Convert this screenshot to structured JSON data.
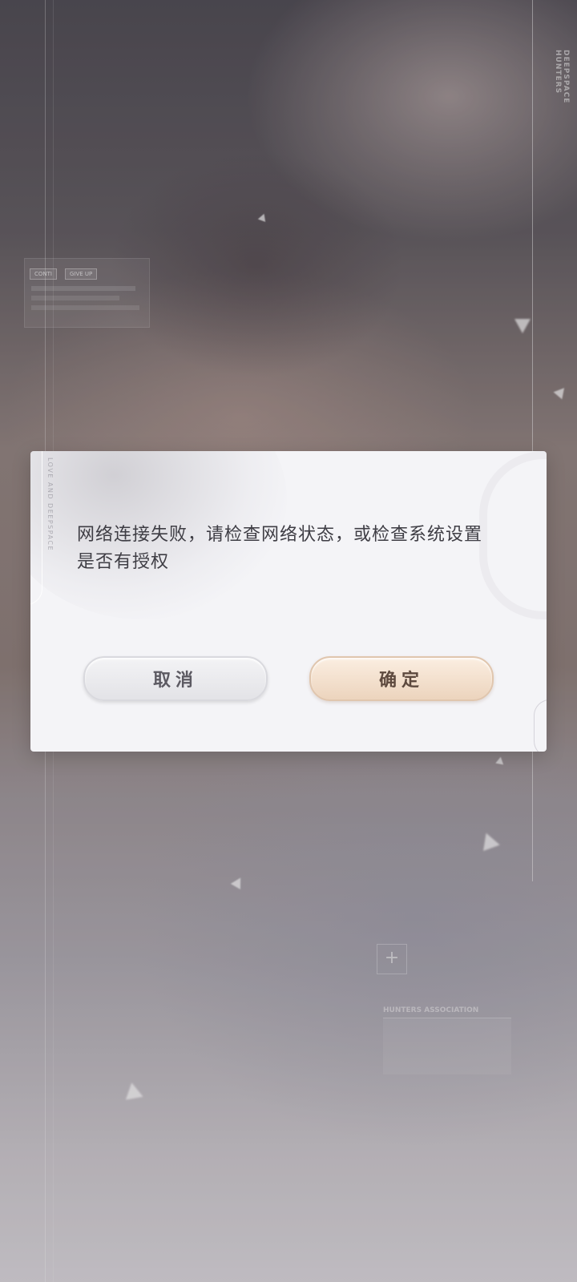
{
  "background": {
    "brand_vertical": "DEEPSPACE HUNTERS",
    "panel_buttons": [
      "CONTI",
      "GIVE UP"
    ],
    "plus_symbol": "+",
    "association_text": "HUNTERS ASSOCIATION"
  },
  "dialog": {
    "side_label": "LOVE AND DEEPSPACE",
    "message": "网络连接失败，请检查网络状态，或检查系统设置是否有授权",
    "cancel_label": "取消",
    "confirm_label": "确定"
  },
  "colors": {
    "dialog_bg": "#f4f4f7",
    "confirm_accent": "#ecd4bd",
    "text": "#3e3d44"
  }
}
